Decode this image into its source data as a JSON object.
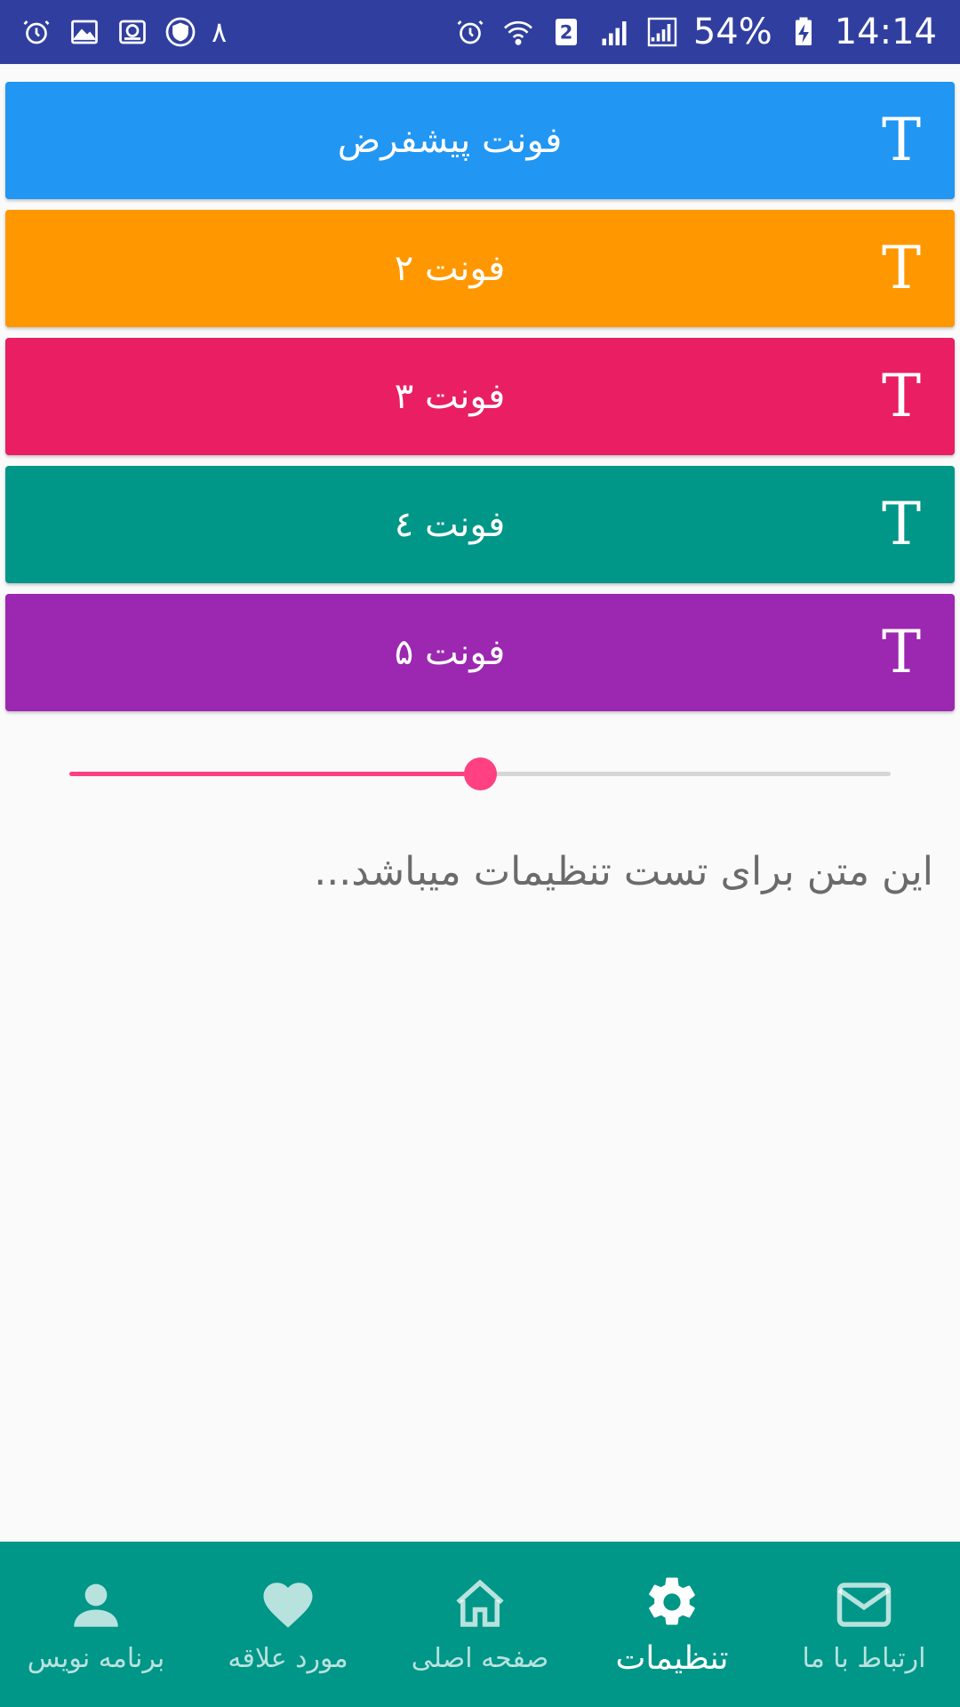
{
  "status_bar": {
    "notification_count": "٨",
    "sim_badge": "2",
    "battery": "54%",
    "time": "14:14",
    "left_icons": [
      "alarm-icon",
      "gallery-icon",
      "sync-drive-icon",
      "shield-icon"
    ],
    "right_icons": [
      "alarm-icon",
      "wifi-icon",
      "sim-icon",
      "signal-icon",
      "signal-icon",
      "battery-charging-icon"
    ]
  },
  "font_cards": [
    {
      "label": "فونت پیشفرض",
      "color": "#2196f3",
      "icon": "T"
    },
    {
      "label": "فونت ۲",
      "color": "#ff9800",
      "icon": "T"
    },
    {
      "label": "فونت ۳",
      "color": "#e91e63",
      "icon": "T"
    },
    {
      "label": "فونت ٤",
      "color": "#009688",
      "icon": "T"
    },
    {
      "label": "فونت ۵",
      "color": "#9c27b0",
      "icon": "T"
    }
  ],
  "slider": {
    "value_fraction": 0.5,
    "accent": "#ff4081"
  },
  "sample_text": "این متن برای تست تنظیمات میباشد...",
  "bottom_nav": {
    "items": [
      {
        "label": "ارتباط با ما",
        "icon": "mail-icon",
        "active": false
      },
      {
        "label": "تنظیمات",
        "icon": "gear-icon",
        "active": true
      },
      {
        "label": "صفحه اصلی",
        "icon": "home-icon",
        "active": false
      },
      {
        "label": "مورد علاقه",
        "icon": "heart-icon",
        "active": false
      },
      {
        "label": "برنامه نویس",
        "icon": "person-icon",
        "active": false
      }
    ],
    "background": "#009688"
  }
}
